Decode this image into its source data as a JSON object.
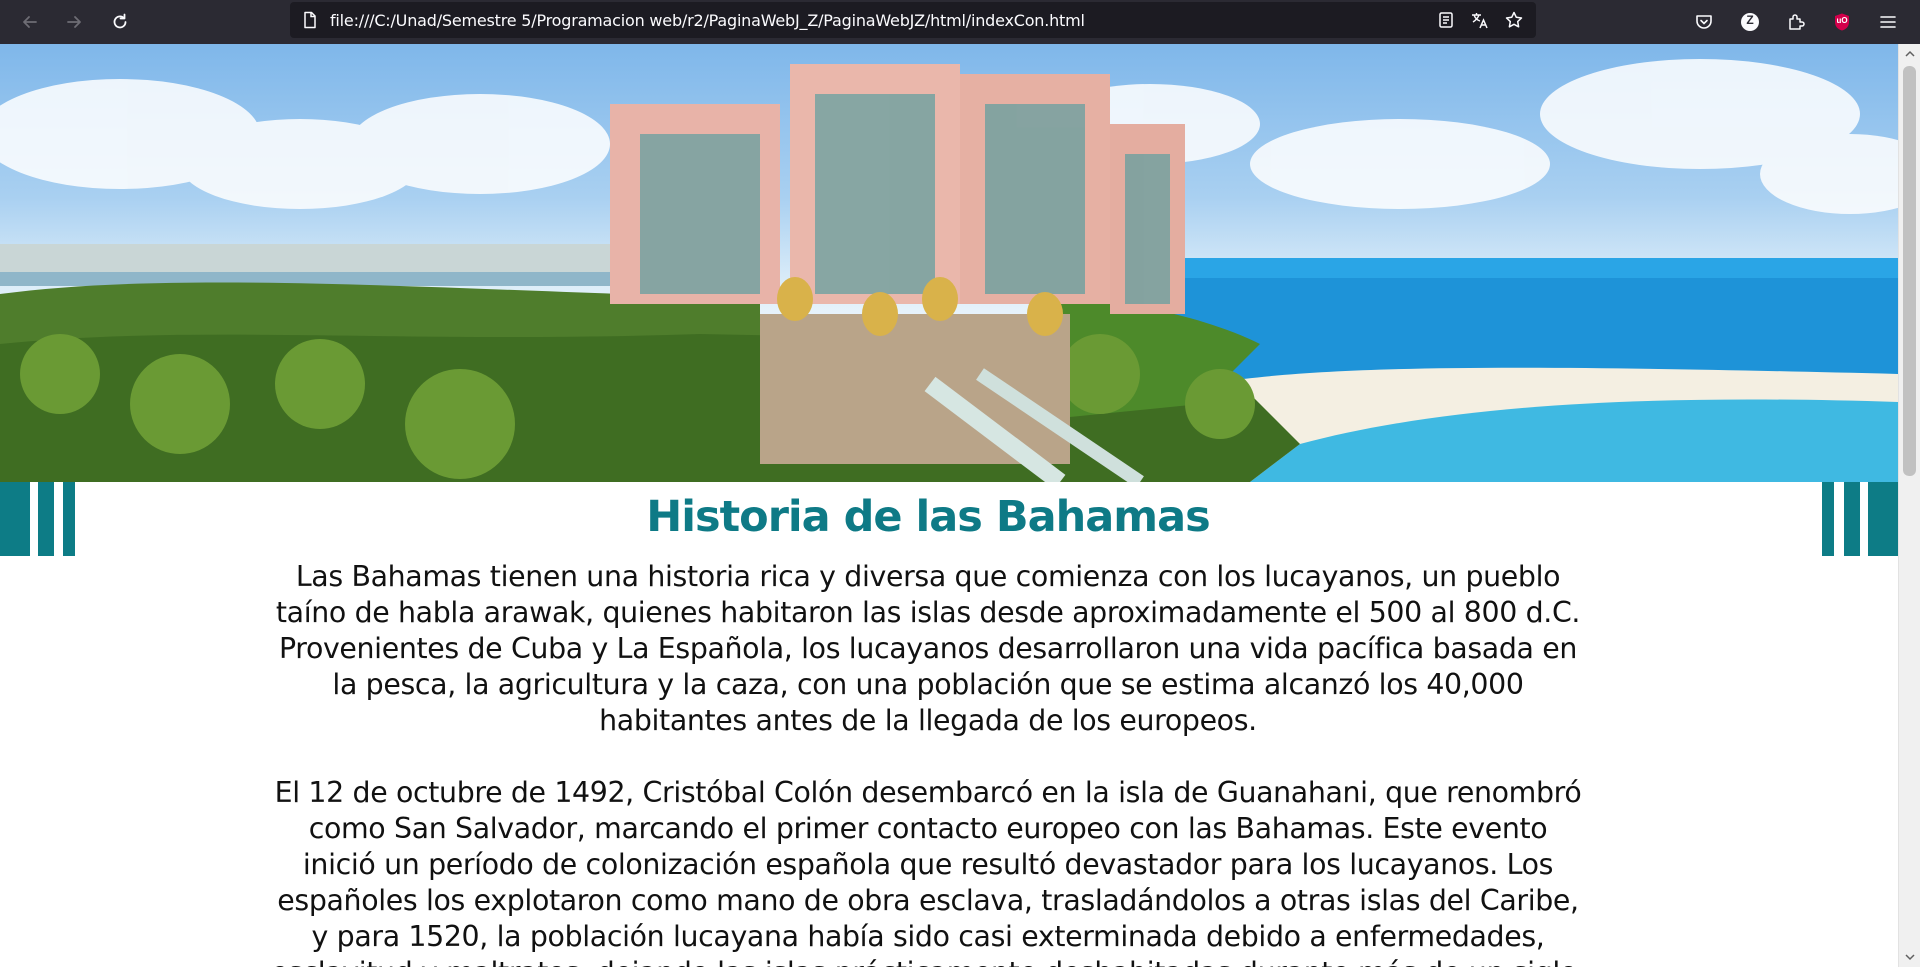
{
  "browser": {
    "url": "file:///C:/Unad/Semestre 5/Programacion web/r2/PaginaWebJ_Z/PaginaWebJZ/html/indexCon.html",
    "colors": {
      "toolbar": "#2b2a33",
      "urlbar": "#1c1b22",
      "ublock": "#d4004b"
    },
    "nav": {
      "back_icon": "arrow-left-icon",
      "forward_icon": "arrow-right-icon",
      "reload_icon": "reload-icon"
    },
    "url_icons": [
      "reader-view-icon",
      "translate-icon",
      "bookmark-star-icon"
    ],
    "toolbar_icons": [
      "pocket-icon",
      "account-z-icon",
      "extensions-icon",
      "ublock-icon",
      "menu-icon"
    ],
    "account_letter": "Z",
    "ublock_label": "uO"
  },
  "page": {
    "hero_image": "resort-hotel-beach-photo",
    "accent_color": "#0e7a86",
    "title": "Historia de las Bahamas",
    "paragraphs": [
      "Las Bahamas tienen una historia rica y diversa que comienza con los lucayanos, un pueblo taíno de habla arawak, quienes habitaron las islas desde aproximadamente el 500 al 800 d.C. Provenientes de Cuba y La Española, los lucayanos desarrollaron una vida pacífica basada en la pesca, la agricultura y la caza, con una población que se estima alcanzó los 40,000 habitantes antes de la llegada de los europeos.",
      "El 12 de octubre de 1492, Cristóbal Colón desembarcó en la isla de Guanahani, que renombró como San Salvador, marcando el primer contacto europeo con las Bahamas. Este evento inició un período de colonización española que resultó devastador para los lucayanos. Los españoles los explotaron como mano de obra esclava, trasladándolos a otras islas del Caribe, y para 1520, la población lucayana había sido casi exterminada debido a enfermedades, esclavitud y maltratos, dejando las islas prácticamente deshabitadas durante más de un siglo."
    ]
  }
}
